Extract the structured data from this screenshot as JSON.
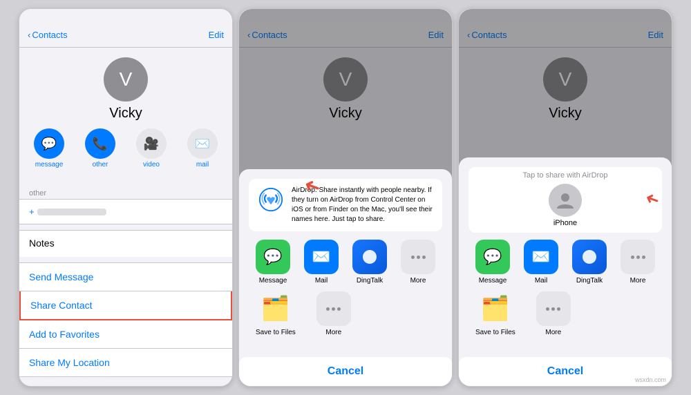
{
  "panels": [
    {
      "id": "panel1",
      "nav": {
        "back_label": "Contacts",
        "title": "",
        "edit_label": "Edit"
      },
      "contact": {
        "avatar_letter": "V",
        "name": "Vicky"
      },
      "actions": [
        {
          "label": "message",
          "icon": "💬",
          "style": "blue"
        },
        {
          "label": "other",
          "icon": "📞",
          "style": "blue"
        },
        {
          "label": "video",
          "icon": "🎥",
          "style": "gray"
        },
        {
          "label": "mail",
          "icon": "✉️",
          "style": "gray"
        }
      ],
      "section_label": "other",
      "links": [
        {
          "text": "Send Message",
          "highlighted": false
        },
        {
          "text": "Share Contact",
          "highlighted": true
        },
        {
          "text": "Add to Favorites",
          "highlighted": false
        },
        {
          "text": "Share My Location",
          "highlighted": false
        }
      ],
      "notes_label": "Notes"
    },
    {
      "id": "panel2",
      "nav": {
        "back_label": "Contacts",
        "title": "",
        "edit_label": "Edit"
      },
      "contact": {
        "avatar_letter": "V",
        "name": "Vicky"
      },
      "share_sheet": {
        "airdrop_title": "AirDrop",
        "airdrop_text": "AirDrop. Share instantly with people nearby. If they turn on AirDrop from Control Center on iOS or from Finder on the Mac, you'll see their names here. Just tap to share.",
        "apps": [
          {
            "label": "Message",
            "style": "green"
          },
          {
            "label": "Mail",
            "style": "blue-mail"
          },
          {
            "label": "DingTalk",
            "style": "teal"
          },
          {
            "label": "More",
            "style": "more"
          }
        ],
        "files": [
          {
            "label": "Save to Files",
            "style": "folder"
          },
          {
            "label": "More",
            "style": "more"
          }
        ],
        "cancel_label": "Cancel"
      }
    },
    {
      "id": "panel3",
      "nav": {
        "back_label": "Contacts",
        "title": "",
        "edit_label": "Edit"
      },
      "contact": {
        "avatar_letter": "V",
        "name": "Vicky"
      },
      "share_sheet": {
        "airdrop_tap_label": "Tap to share with AirDrop",
        "person_name": "iPhone",
        "apps": [
          {
            "label": "Message",
            "style": "green"
          },
          {
            "label": "Mail",
            "style": "blue-mail"
          },
          {
            "label": "DingTalk",
            "style": "teal"
          },
          {
            "label": "More",
            "style": "more"
          }
        ],
        "files": [
          {
            "label": "Save to Files",
            "style": "folder"
          },
          {
            "label": "More",
            "style": "more"
          }
        ],
        "cancel_label": "Cancel"
      }
    }
  ],
  "watermark": "wsxdn.com"
}
